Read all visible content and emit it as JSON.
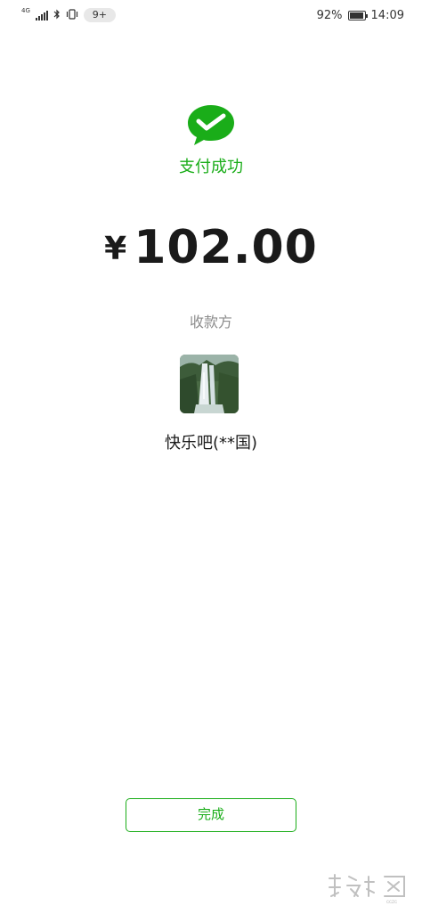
{
  "status_bar": {
    "network_type": "4G",
    "notification_badge": "9+",
    "battery_percent": "92%",
    "battery_level": 0.92,
    "time": "14:09",
    "icons": [
      "signal-icon",
      "bluetooth-icon",
      "vibrate-icon",
      "battery-icon"
    ]
  },
  "payment": {
    "status_text": "支付成功",
    "currency_symbol": "¥",
    "amount": "102.00",
    "payee_label": "收款方",
    "payee_name": "快乐吧(**国)"
  },
  "actions": {
    "done_label": "完成"
  },
  "colors": {
    "accent": "#1aad19",
    "muted_text": "#8c8c8c",
    "primary_text": "#1a1a1a"
  }
}
